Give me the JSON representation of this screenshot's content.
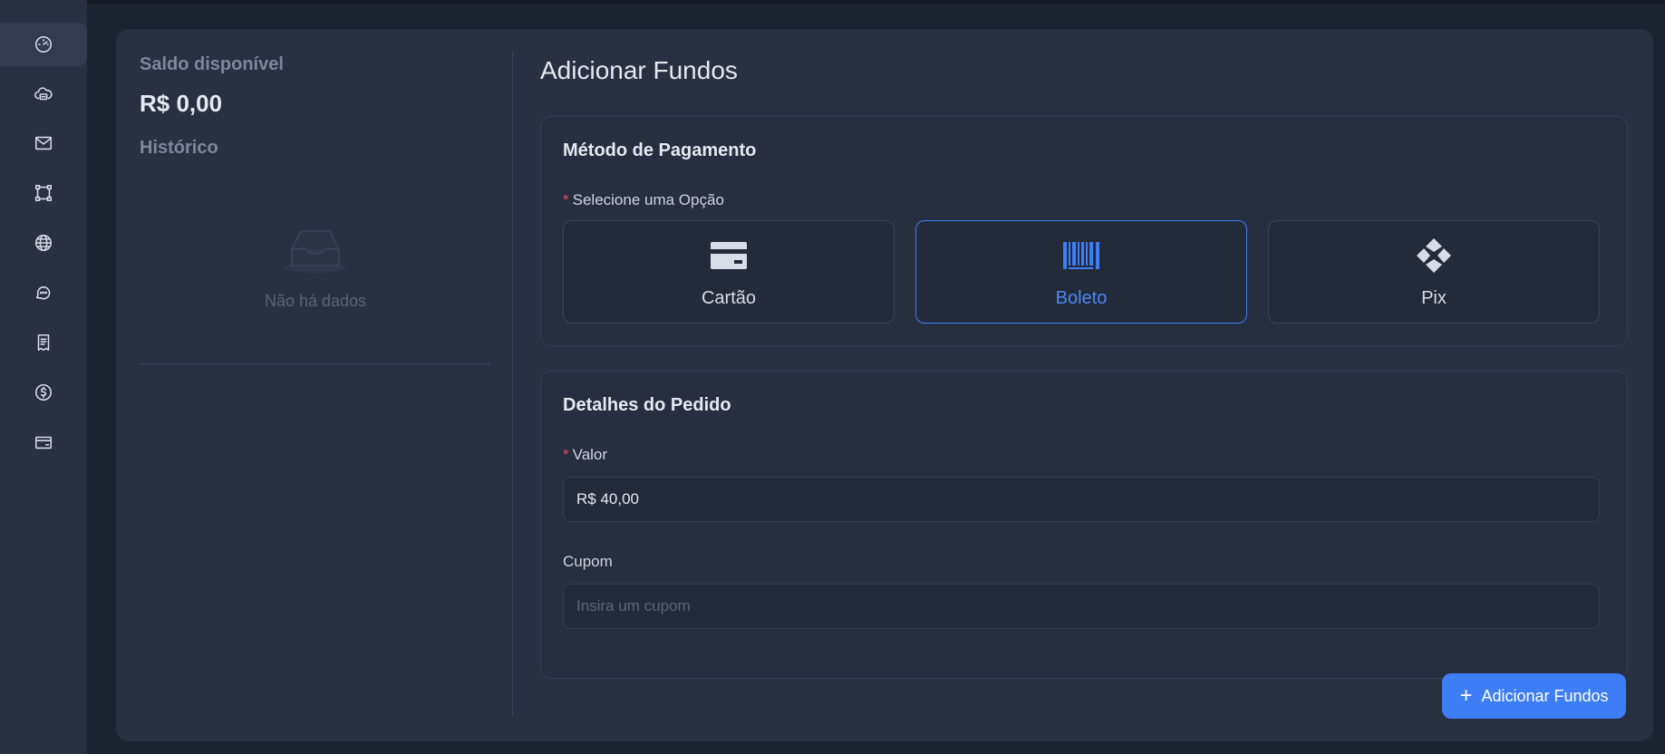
{
  "sidebar": {
    "items": [
      {
        "icon": "dashboard-icon",
        "active": true
      },
      {
        "icon": "cloud-server-icon"
      },
      {
        "icon": "mail-icon"
      },
      {
        "icon": "network-nodes-icon"
      },
      {
        "icon": "globe-icon"
      },
      {
        "icon": "chat-icon"
      },
      {
        "icon": "invoice-icon"
      },
      {
        "icon": "dollar-icon"
      },
      {
        "icon": "credit-card-icon"
      }
    ]
  },
  "balance": {
    "label": "Saldo disponível",
    "value": "R$ 0,00",
    "history_label": "Histórico",
    "empty_text": "Não há dados"
  },
  "main": {
    "title": "Adicionar Fundos",
    "payment": {
      "title": "Método de Pagamento",
      "required_mark": "*",
      "select_label": "Selecione uma Opção",
      "options": [
        {
          "label": "Cartão",
          "icon": "card-icon",
          "selected": false
        },
        {
          "label": "Boleto",
          "icon": "barcode-icon",
          "selected": true
        },
        {
          "label": "Pix",
          "icon": "pix-icon",
          "selected": false
        }
      ]
    },
    "order": {
      "title": "Detalhes do Pedido",
      "required_mark": "*",
      "value_label": "Valor",
      "value_input": "R$ 40,00",
      "coupon_label": "Cupom",
      "coupon_placeholder": "Insira um cupom"
    },
    "submit_label": "Adicionar Fundos"
  },
  "colors": {
    "accent": "#3d7ef7",
    "required": "#e5484d",
    "background": "#1c2331",
    "card": "#283042"
  }
}
